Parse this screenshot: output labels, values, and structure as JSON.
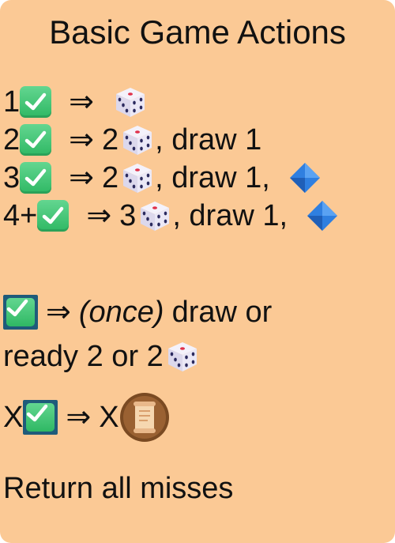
{
  "title": "Basic Game Actions",
  "rows": [
    {
      "count": "1",
      "arrow": "⇒",
      "tail": ""
    },
    {
      "count": "2",
      "arrow": "⇒",
      "num": "2",
      "tail": ", draw 1"
    },
    {
      "count": "3",
      "arrow": "⇒",
      "num": "2",
      "tail": ", draw 1,"
    },
    {
      "count": "4+",
      "arrow": "⇒",
      "num": "3",
      "tail": ", draw 1,"
    }
  ],
  "special": {
    "arrow": "⇒",
    "once": "(once)",
    "line1_tail": "draw or",
    "line2": "ready 2 or 2"
  },
  "x_row": {
    "prefix": "X",
    "arrow": "⇒",
    "result": "X"
  },
  "footer": "Return all misses",
  "icons": {
    "success": "green-check-icon",
    "die": "die-icon",
    "gem": "blue-diamond-icon",
    "scroll": "scroll-icon"
  },
  "colors": {
    "card": "#fbc995",
    "check": "#3cc872",
    "frame": "#1f5b7a",
    "gem": "#2f7fe0",
    "pip_dark": "#2b2a5e",
    "pip_red": "#e0304a"
  }
}
